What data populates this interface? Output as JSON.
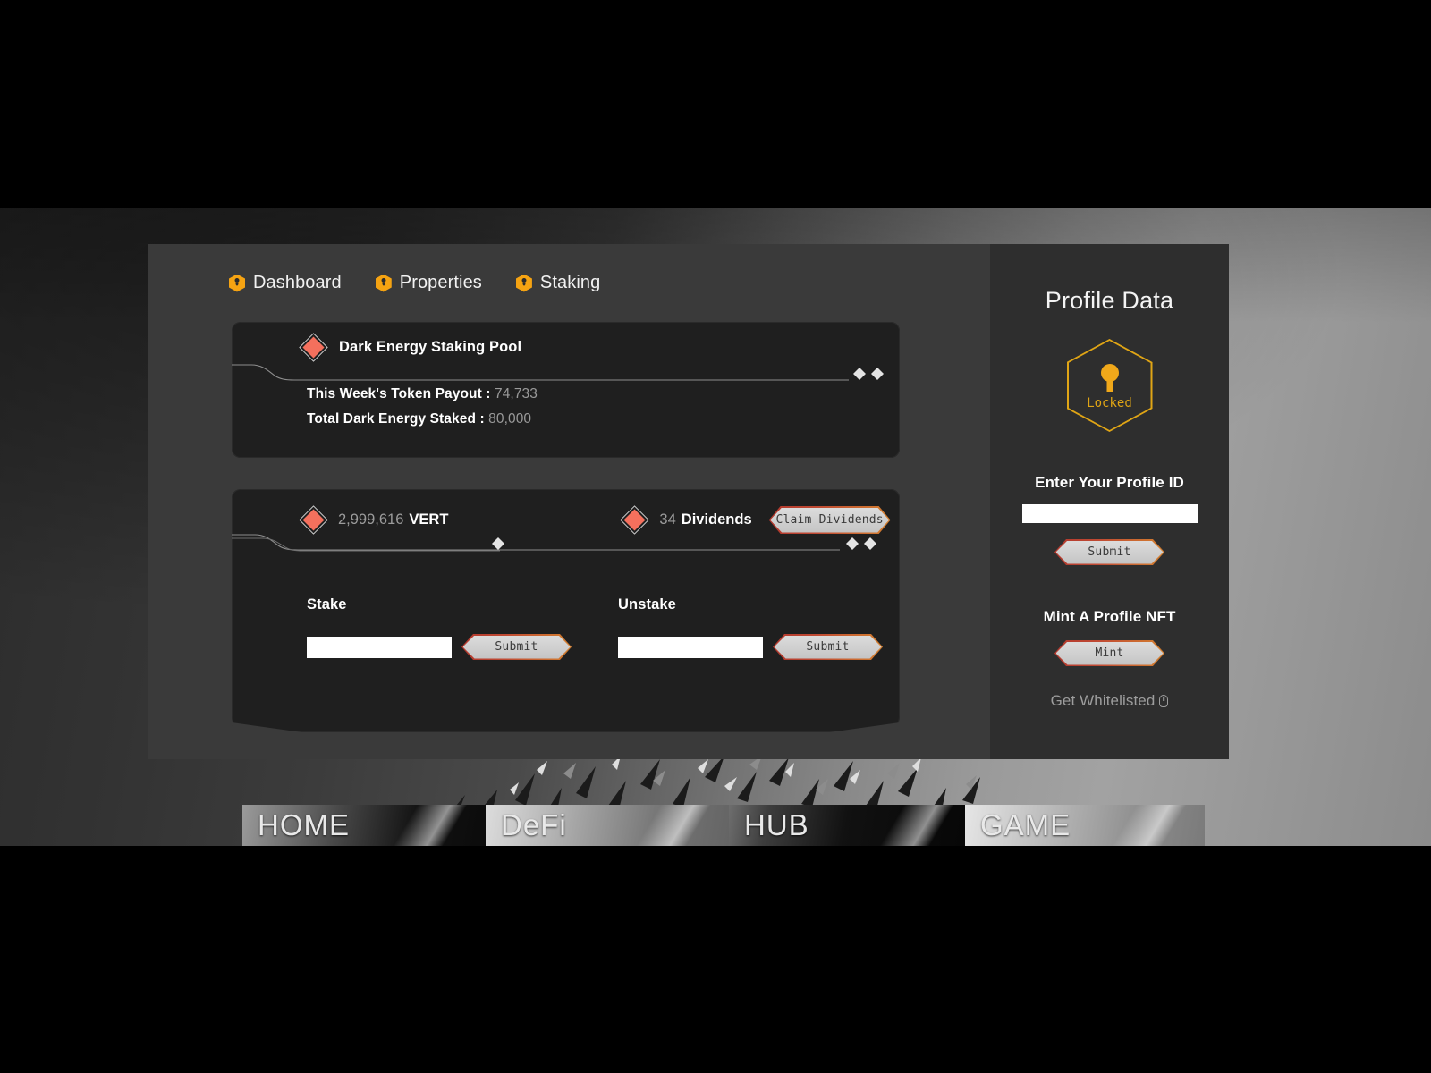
{
  "nav": {
    "items": [
      {
        "label": "Dashboard",
        "icon": "hex-lock-icon"
      },
      {
        "label": "Properties",
        "icon": "hex-lock-icon"
      },
      {
        "label": "Staking",
        "icon": "hex-lock-icon"
      }
    ]
  },
  "pool_card": {
    "title": "Dark Energy Staking Pool",
    "icon": "red-diamond-icon",
    "stats": [
      {
        "label": "This Week's Token Payout :",
        "value": "74,733"
      },
      {
        "label": "Total Dark Energy Staked :",
        "value": "80,000"
      }
    ]
  },
  "stake_card": {
    "balance": {
      "amount": "2,999,616",
      "unit": "VERT",
      "icon": "red-diamond-icon"
    },
    "dividends": {
      "amount": "34",
      "unit": "Dividends",
      "icon": "red-diamond-icon"
    },
    "claim_label": "Claim Dividends",
    "stake": {
      "label": "Stake",
      "value": "",
      "placeholder": "",
      "submit_label": "Submit"
    },
    "unstake": {
      "label": "Unstake",
      "value": "",
      "placeholder": "",
      "submit_label": "Submit"
    }
  },
  "sidebar": {
    "title": "Profile Data",
    "badge": {
      "status": "Locked",
      "icon": "hex-lock-badge-icon"
    },
    "profile_id": {
      "label": "Enter Your Profile ID",
      "value": "",
      "placeholder": "",
      "submit_label": "Submit"
    },
    "mint": {
      "label": "Mint A Profile NFT",
      "button_label": "Mint"
    },
    "whitelist": {
      "label": "Get Whitelisted",
      "icon": "mouse-icon"
    }
  },
  "bottom_tiles": [
    {
      "label": "HOME"
    },
    {
      "label": "DeFi"
    },
    {
      "label": "HUB"
    },
    {
      "label": "GAME"
    }
  ],
  "colors": {
    "accent_orange": "#f5a312",
    "accent_red": "#f4705d",
    "lock_gold": "#e0a515",
    "panel_dark": "#1f1f1f",
    "panel_main": "#3a3a3a",
    "panel_sidebar": "#2e2e2e"
  }
}
